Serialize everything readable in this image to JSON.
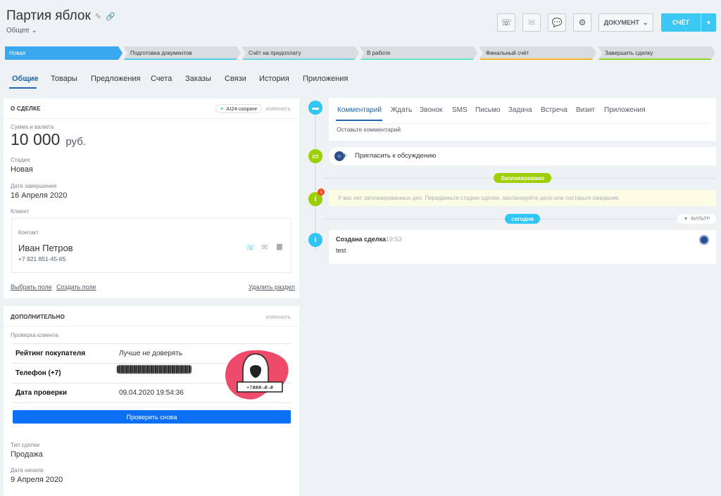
{
  "header": {
    "title": "Партия яблок",
    "category": "Общее",
    "document_label": "ДОКУМЕНТ",
    "invoice_label": "СЧЁТ"
  },
  "stages": [
    {
      "label": "Новая",
      "color": "#39a8ef",
      "active": true
    },
    {
      "label": "Подготовка документов",
      "color": "#2fc6f6",
      "active": false
    },
    {
      "label": "Счёт на предоплату",
      "color": "#55d0e0",
      "active": false
    },
    {
      "label": "В работе",
      "color": "#47e4c2",
      "active": false
    },
    {
      "label": "Финальный счёт",
      "color": "#ffa900",
      "active": false
    },
    {
      "label": "Завершить сделку",
      "color": "#7bd500",
      "active": false
    }
  ],
  "tabs": [
    {
      "label": "Общие",
      "active": true
    },
    {
      "label": "Товары"
    },
    {
      "label": "Предложения"
    },
    {
      "label": "Счета"
    },
    {
      "label": "Заказы"
    },
    {
      "label": "Связи"
    },
    {
      "label": "История"
    },
    {
      "label": "Приложения"
    }
  ],
  "about": {
    "title": "О СДЕЛКЕ",
    "scoring": "AI24-скоринг",
    "edit": "изменить",
    "amount_label": "Сумма и валюта",
    "amount": "10 000",
    "currency": "руб.",
    "stage_label": "Стадия",
    "stage": "Новая",
    "close_label": "Дата завершения",
    "close_date": "16 Апреля 2020",
    "client_label": "Клиент",
    "contact_label": "Контакт",
    "contact_name": "Иван Петров",
    "contact_phone": "+7 921 851-45-65",
    "select_field": "Выбрать поле",
    "create_field": "Создать поле",
    "delete_section": "Удалить раздел"
  },
  "extra": {
    "title": "ДОПОЛНИТЕЛЬНО",
    "edit": "изменить",
    "check_label": "Проверка клиента",
    "rows": [
      {
        "key": "Рейтинг покупателя",
        "value": "Лучше не доверять"
      },
      {
        "key": "Телефон (+7)",
        "value": ""
      },
      {
        "key": "Дата проверки",
        "value": "09.04.2020 19:54:36"
      }
    ],
    "recheck": "Проверить снова",
    "deal_type_label": "Тип сделки",
    "deal_type": "Продажа",
    "start_label": "Дата начала",
    "start_date": "9 Апреля 2020"
  },
  "timeline": {
    "editor_tabs": [
      "Комментарий",
      "Ждать",
      "Звонок",
      "SMS",
      "Письмо",
      "Задача",
      "Встреча",
      "Визит",
      "Приложения"
    ],
    "comment_placeholder": "Оставьте комментарий",
    "invite": "Пригласить к обсуждению",
    "planned": "Запланировано",
    "no_plans": "У вас нет запланированных дел. Передвиньте стадию сделки, запланируйте дело или поставьте ожидание.",
    "today": "сегодня",
    "filter": "ФИЛЬТР",
    "created_title": "Создана сделка",
    "created_time": "19:53",
    "created_text": "test",
    "badge_count": "1"
  }
}
